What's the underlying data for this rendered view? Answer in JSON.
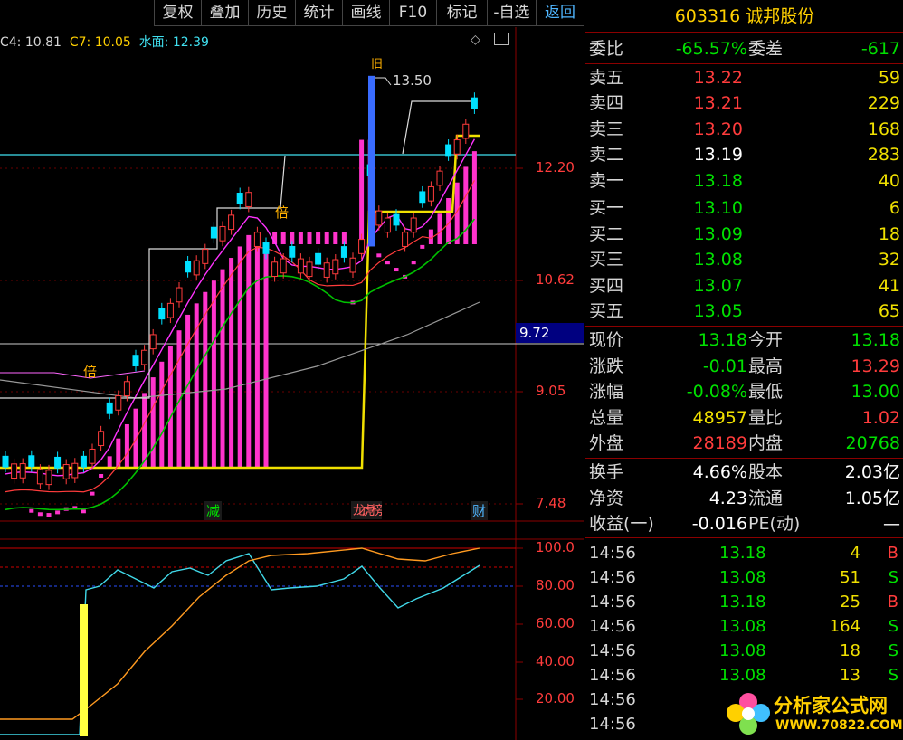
{
  "toolbar": {
    "buttons": [
      "复权",
      "叠加",
      "历史",
      "统计",
      "画线",
      "F10",
      "标记",
      "-自选",
      "返回"
    ],
    "active_index": 8
  },
  "legend": {
    "c4": "C4: 10.81",
    "c7": "C7: 10.05",
    "water": "水面: 12.39"
  },
  "chart_labels": {
    "peak_price": "13.50",
    "price_ticks": [
      "12.20",
      "10.62",
      "9.05",
      "7.48"
    ],
    "current_price_tag": "9.72",
    "osc_ticks": [
      "100.0",
      "80.00",
      "60.00",
      "40.00",
      "20.00"
    ],
    "bei_marker": "倍",
    "jiu_marker": "旧",
    "event_jian": "减",
    "event_longhu": "龙虎榜",
    "event_cai": "财"
  },
  "colors": {
    "up": "#ff3c3c",
    "down": "#00e0ff",
    "volume": "#ff33cc",
    "water_line": "#f0e000",
    "cyan_line": "#40e0f0",
    "panel_border": "#8b0000"
  },
  "panel": {
    "title": "603316  诚邦股份",
    "weibi": {
      "label": "委比",
      "value": "-65.57%",
      "label2": "委差",
      "value2": "-617"
    },
    "asks": [
      {
        "label": "卖五",
        "price": "13.22",
        "vol": "59",
        "color": "red"
      },
      {
        "label": "卖四",
        "price": "13.21",
        "vol": "229",
        "color": "red"
      },
      {
        "label": "卖三",
        "price": "13.20",
        "vol": "168",
        "color": "red"
      },
      {
        "label": "卖二",
        "price": "13.19",
        "vol": "283",
        "color": "white"
      },
      {
        "label": "卖一",
        "price": "13.18",
        "vol": "40",
        "color": "green"
      }
    ],
    "bids": [
      {
        "label": "买一",
        "price": "13.10",
        "vol": "6",
        "color": "green"
      },
      {
        "label": "买二",
        "price": "13.09",
        "vol": "18",
        "color": "green"
      },
      {
        "label": "买三",
        "price": "13.08",
        "vol": "32",
        "color": "green"
      },
      {
        "label": "买四",
        "price": "13.07",
        "vol": "41",
        "color": "green"
      },
      {
        "label": "买五",
        "price": "13.05",
        "vol": "65",
        "color": "green"
      }
    ],
    "quote": [
      {
        "l1": "现价",
        "v1": "13.18",
        "c1": "green",
        "l2": "今开",
        "v2": "13.18",
        "c2": "green"
      },
      {
        "l1": "涨跌",
        "v1": "-0.01",
        "c1": "green",
        "l2": "最高",
        "v2": "13.29",
        "c2": "red"
      },
      {
        "l1": "涨幅",
        "v1": "-0.08%",
        "c1": "green",
        "l2": "最低",
        "v2": "13.00",
        "c2": "green"
      },
      {
        "l1": "总量",
        "v1": "48957",
        "c1": "yellow",
        "l2": "量比",
        "v2": "1.02",
        "c2": "red"
      },
      {
        "l1": "外盘",
        "v1": "28189",
        "c1": "red",
        "l2": "内盘",
        "v2": "20768",
        "c2": "green"
      }
    ],
    "fundamentals": [
      {
        "l1": "换手",
        "v1": "4.66%",
        "l2": "股本",
        "v2": "2.03亿"
      },
      {
        "l1": "净资",
        "v1": "4.23",
        "l2": "流通",
        "v2": "1.05亿"
      },
      {
        "l1": "收益(一)",
        "v1": "-0.016",
        "l2": "PE(动)",
        "v2": "—"
      }
    ],
    "trades": [
      {
        "time": "14:56",
        "price": "13.18",
        "price_color": "green",
        "vol": "4",
        "side": "B",
        "side_color": "red"
      },
      {
        "time": "14:56",
        "price": "13.08",
        "price_color": "green",
        "vol": "51",
        "side": "S",
        "side_color": "green"
      },
      {
        "time": "14:56",
        "price": "13.18",
        "price_color": "green",
        "vol": "25",
        "side": "B",
        "side_color": "red"
      },
      {
        "time": "14:56",
        "price": "13.08",
        "price_color": "green",
        "vol": "164",
        "side": "S",
        "side_color": "green"
      },
      {
        "time": "14:56",
        "price": "13.08",
        "price_color": "green",
        "vol": "18",
        "side": "S",
        "side_color": "green"
      },
      {
        "time": "14:56",
        "price": "13.08",
        "price_color": "green",
        "vol": "13",
        "side": "S",
        "side_color": "green"
      },
      {
        "time": "14:56",
        "price": "",
        "price_color": "green",
        "vol": "",
        "side": "",
        "side_color": "green"
      },
      {
        "time": "14:56",
        "price": "",
        "price_color": "green",
        "vol": "",
        "side": "",
        "side_color": "green"
      }
    ]
  },
  "watermark": {
    "text": "分析家公式网",
    "url": "WWW.70822.COM"
  }
}
